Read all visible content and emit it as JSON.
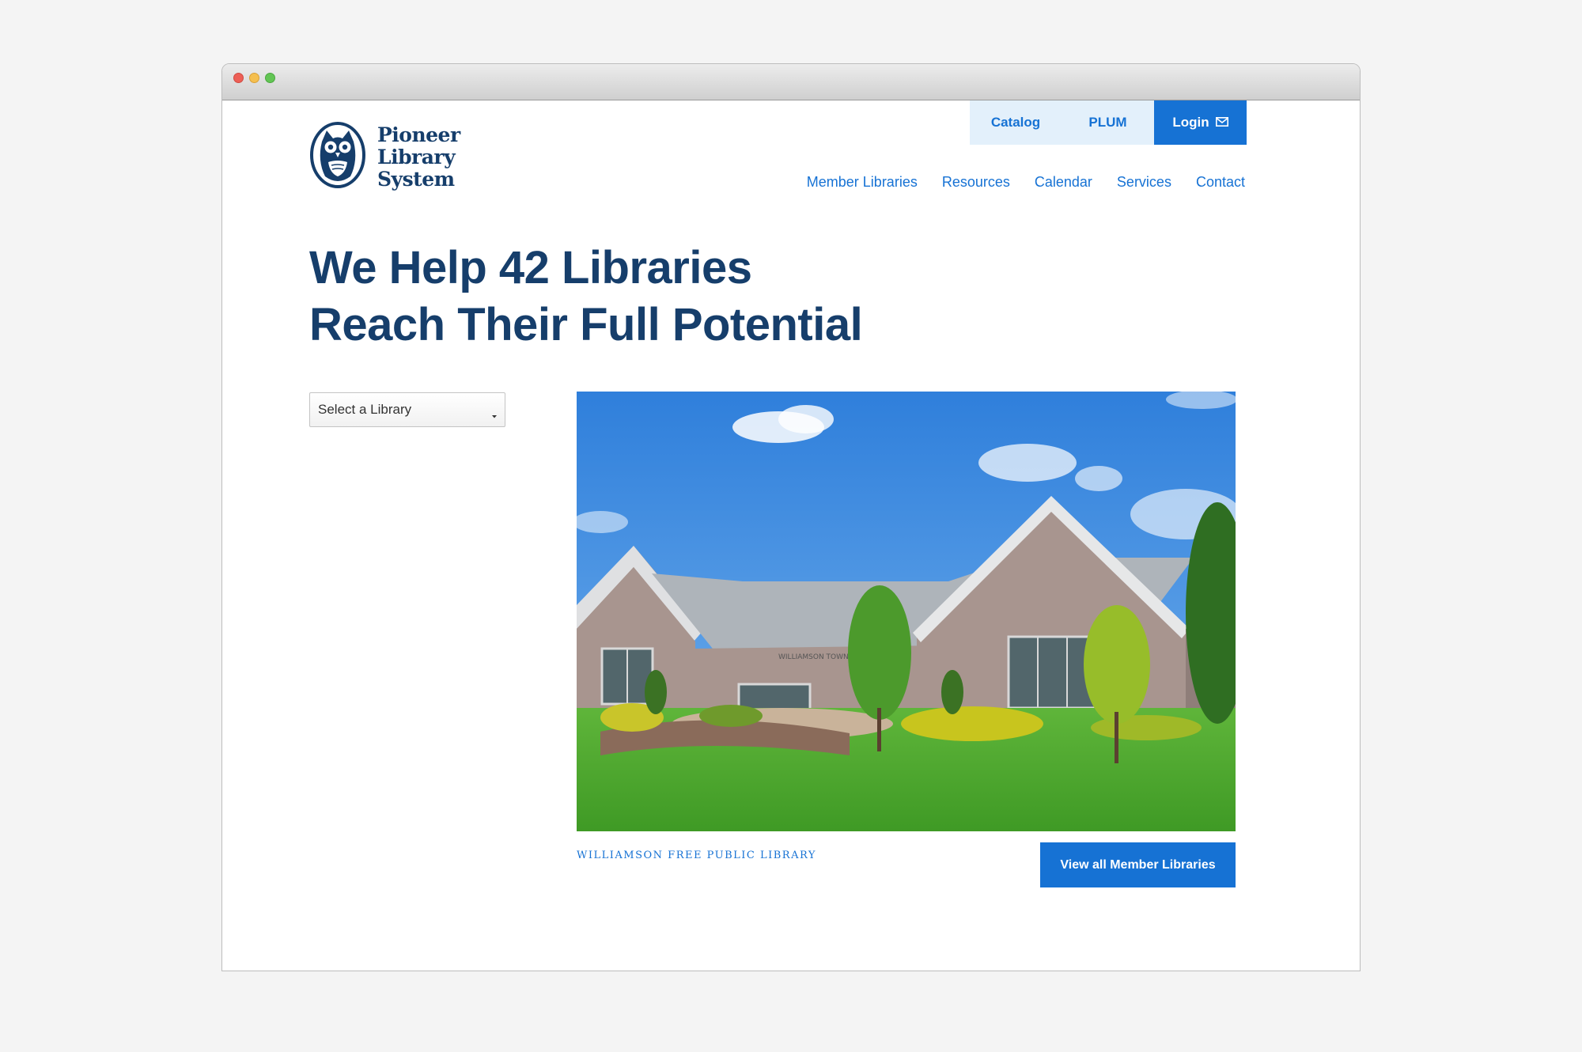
{
  "logo": {
    "line1": "Pioneer",
    "line2": "Library",
    "line3": "System",
    "icon": "owl-icon"
  },
  "utility_nav": {
    "catalog": "Catalog",
    "plum": "PLUM",
    "login": "Login",
    "login_icon": "envelope-icon"
  },
  "main_nav": [
    "Member Libraries",
    "Resources",
    "Calendar",
    "Services",
    "Contact"
  ],
  "hero": {
    "line1": "We Help 42 Libraries",
    "line2": "Reach Their Full Potential"
  },
  "library_select": {
    "selected": "Select a Library",
    "icon": "caret-down-icon"
  },
  "featured": {
    "photo_sign_text": "WILLIAMSON TOWN C",
    "caption": "WILLIAMSON FREE PUBLIC LIBRARY",
    "cta": "View all Member Libraries"
  },
  "colors": {
    "brand_navy": "#163e6b",
    "link_blue": "#1672d4",
    "util_bg": "#e3f0fb",
    "page_bg": "#f4f4f4"
  }
}
